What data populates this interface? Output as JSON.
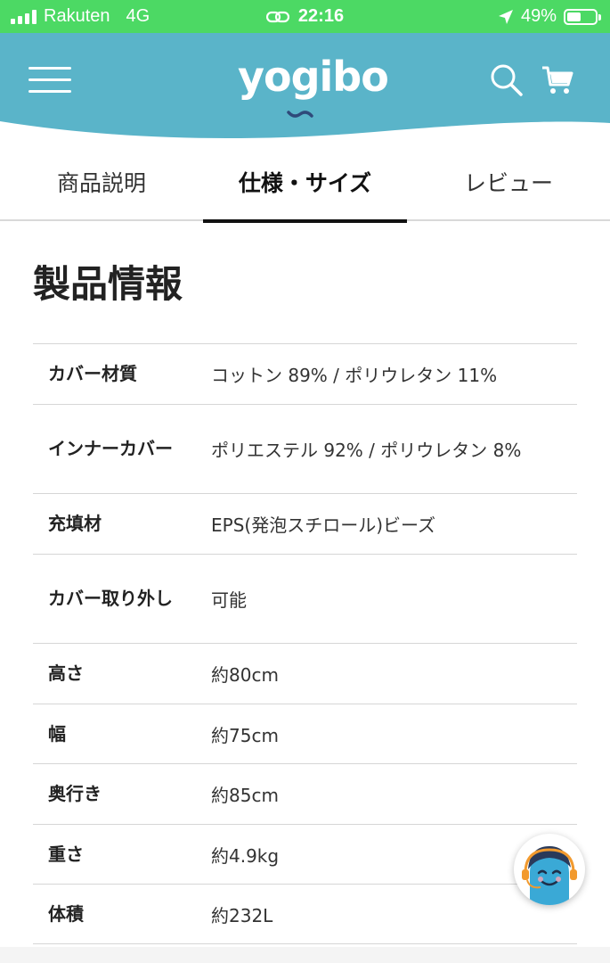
{
  "status_bar": {
    "carrier": "Rakuten",
    "network": "4G",
    "time": "22:16",
    "battery": "49%",
    "battery_level": 0.49,
    "color": "#4cd964"
  },
  "header": {
    "logo": "yogibo",
    "brand_color": "#5ab4c9",
    "icons": [
      "menu-icon",
      "search-icon",
      "cart-icon"
    ]
  },
  "tabs": [
    {
      "label": "商品説明",
      "active": false
    },
    {
      "label": "仕様・サイズ",
      "active": true
    },
    {
      "label": "レビュー",
      "active": false
    }
  ],
  "section_title": "製品情報",
  "specs": [
    {
      "label": "カバー材質",
      "value": "コットン 89% / ポリウレタン 11%"
    },
    {
      "label": "インナーカバー",
      "value": "ポリエステル 92% / ポリウレタン 8%"
    },
    {
      "label": "充填材",
      "value": "EPS(発泡スチロール)ビーズ"
    },
    {
      "label": "カバー取り外し",
      "value": "可能"
    },
    {
      "label": "高さ",
      "value": "約80cm"
    },
    {
      "label": "幅",
      "value": "約75cm"
    },
    {
      "label": "奥行き",
      "value": "約85cm"
    },
    {
      "label": "重さ",
      "value": "約4.9kg"
    },
    {
      "label": "体積",
      "value": "約232L"
    }
  ],
  "chat": {
    "icon": "support-avatar-icon"
  }
}
